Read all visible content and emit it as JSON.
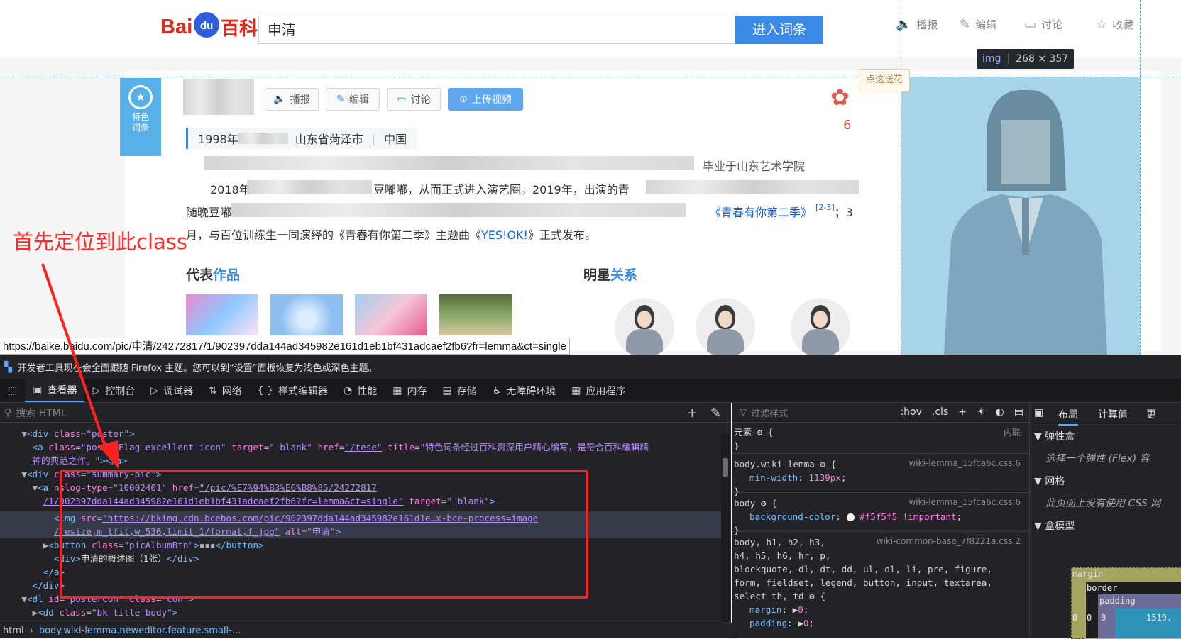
{
  "header": {
    "logo_text_a": "Bai",
    "logo_text_b": "du",
    "logo_text_c": "百科",
    "search_value": "申清",
    "search_button": "进入词条",
    "actions": [
      "播报",
      "编辑",
      "讨论",
      "收藏"
    ]
  },
  "feature_badge": {
    "label_line1": "特色",
    "label_line2": "词条"
  },
  "lemma_buttons": [
    "播报",
    "编辑",
    "讨论",
    "上传视频"
  ],
  "flower_count": "6",
  "info_line": {
    "birth": "1998年",
    "place": "山东省菏泽市",
    "country": "中国"
  },
  "summary": {
    "line1_end": "毕业于山东艺术学院",
    "line2_start": "2018年",
    "line2_mid": "豆嘟嘟，从而正式进入演艺圈。2019年，出演的青",
    "line3_start": "随晚豆嘟",
    "line3_link": "《青春有你第二季》",
    "line3_ref": "[2-3]",
    "line3_end": "；3",
    "line4": "月，与百位训练生一同演绎的《青春有你第二季》主题曲《",
    "line4_link": "YES!OK!",
    "line4_end": "》正式发布。"
  },
  "sections": {
    "works_a": "代表",
    "works_b": "作品",
    "relations_a": "明星",
    "relations_b": "关系"
  },
  "image_tooltip": {
    "tag": "img",
    "size": "268 × 357"
  },
  "bubble": "点这送花",
  "status_url": "https://baike.baidu.com/pic/申清/24272817/1/902397dda144ad345982e161d1eb1bf431adcaef2fb6?fr=lemma&ct=single",
  "annotation": "首先定位到此class",
  "devtools": {
    "notice": "开发者工具现在会全面跟随 Firefox 主题。您可以到“设置”面板恢复为浅色或深色主题。",
    "tabs": [
      "查看器",
      "控制台",
      "调试器",
      "网络",
      "样式编辑器",
      "性能",
      "内存",
      "存储",
      "无障碍环境",
      "应用程序"
    ],
    "search_placeholder": "搜索 HTML",
    "breadcrumb": [
      "html",
      "body.wiki-lemma.neweditor.feature.small-..."
    ],
    "filter_placeholder": "过滤样式",
    "hov": ":hov",
    "cls": ".cls",
    "element_label": "元素",
    "inline_label": "内联",
    "layout_tabs": [
      "布局",
      "计算值",
      "更"
    ],
    "flexbox_title": "弹性盒",
    "flexbox_hint": "选择一个弹性 (Flex) 容",
    "grid_title": "网格",
    "grid_hint": "此页面上没有使用 CSS 网",
    "boxmodel_title": "盒模型",
    "box_labels": {
      "margin": "margin",
      "border": "border",
      "padding": "padding",
      "m": "0",
      "b": "0",
      "p": "0",
      "content": "1519."
    }
  }
}
